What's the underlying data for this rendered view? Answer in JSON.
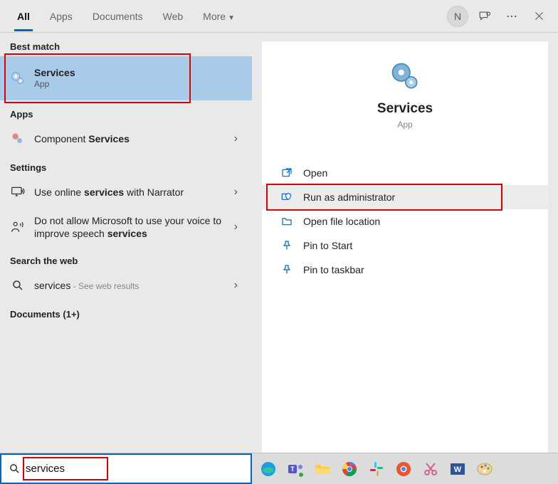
{
  "tabs": {
    "all": "All",
    "apps": "Apps",
    "documents": "Documents",
    "web": "Web",
    "more": "More"
  },
  "user_initial": "N",
  "sections": {
    "best_match": "Best match",
    "apps": "Apps",
    "settings": "Settings",
    "search_web": "Search the web",
    "documents": "Documents (1+)"
  },
  "best_match": {
    "title": "Services",
    "subtitle": "App"
  },
  "apps_results": {
    "component_prefix": "Component ",
    "component_bold": "Services"
  },
  "settings_results": {
    "online_prefix": "Use online ",
    "online_bold": "services",
    "online_suffix": " with Narrator",
    "speech_prefix": "Do not allow Microsoft to use your voice to improve speech ",
    "speech_bold": "services"
  },
  "web_results": {
    "term": "services",
    "suffix": " - See web results"
  },
  "detail": {
    "title": "Services",
    "subtitle": "App"
  },
  "actions": {
    "open": "Open",
    "run_admin": "Run as administrator",
    "open_loc": "Open file location",
    "pin_start": "Pin to Start",
    "pin_taskbar": "Pin to taskbar"
  },
  "search_value": "services"
}
